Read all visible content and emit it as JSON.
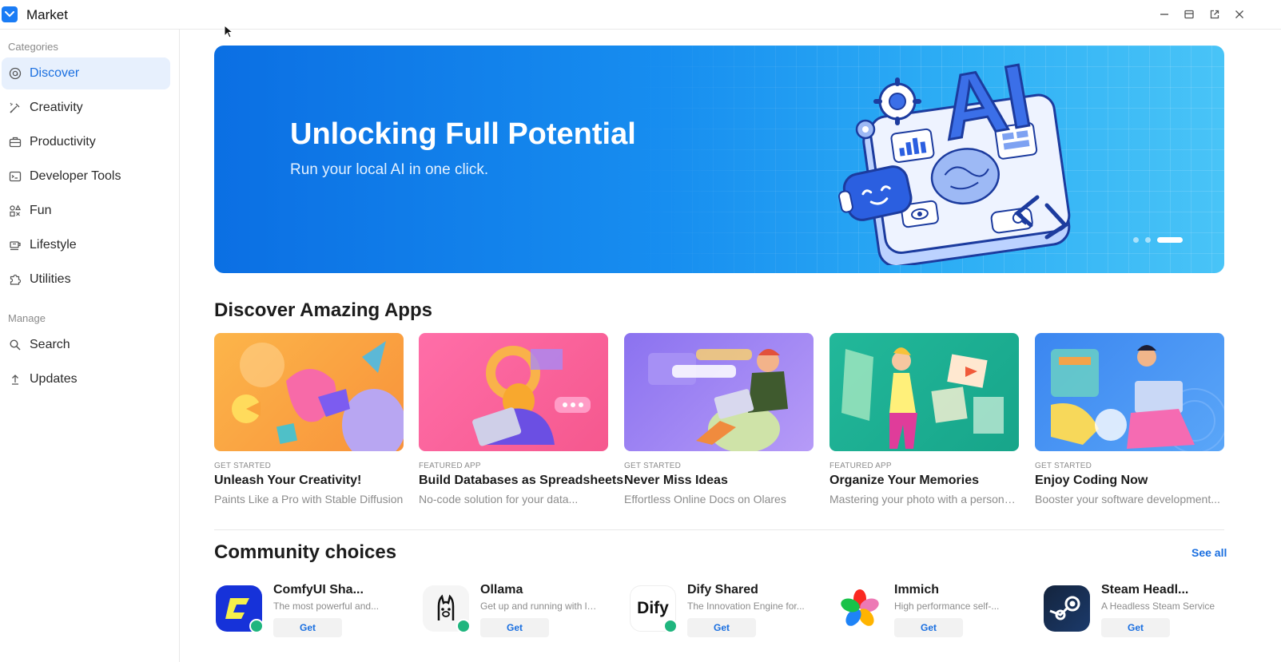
{
  "window": {
    "title": "Market"
  },
  "sidebar": {
    "categories_label": "Categories",
    "categories": [
      {
        "label": "Discover",
        "icon": "discover-icon"
      },
      {
        "label": "Creativity",
        "icon": "brush-icon"
      },
      {
        "label": "Productivity",
        "icon": "briefcase-icon"
      },
      {
        "label": "Developer Tools",
        "icon": "terminal-icon"
      },
      {
        "label": "Fun",
        "icon": "shapes-icon"
      },
      {
        "label": "Lifestyle",
        "icon": "cup-icon"
      },
      {
        "label": "Utilities",
        "icon": "puzzle-icon"
      }
    ],
    "manage_label": "Manage",
    "manage": [
      {
        "label": "Search",
        "icon": "search-icon"
      },
      {
        "label": "Updates",
        "icon": "upload-icon"
      }
    ]
  },
  "banner": {
    "title": "Unlocking Full Potential",
    "subtitle": "Run your local AI in one click.",
    "art_text": "AI"
  },
  "discover": {
    "heading": "Discover Amazing Apps",
    "cards": [
      {
        "tag": "GET STARTED",
        "title": "Unleash Your Creativity!",
        "desc": "Paints Like a Pro with Stable Diffusion"
      },
      {
        "tag": "FEATURED APP",
        "title": "Build Databases as Spreadsheets",
        "desc": "No-code solution for your data..."
      },
      {
        "tag": "GET STARTED",
        "title": "Never Miss Ideas",
        "desc": "Effortless Online Docs on Olares"
      },
      {
        "tag": "FEATURED APP",
        "title": "Organize Your Memories",
        "desc": "Mastering your photo with a personal..."
      },
      {
        "tag": "GET STARTED",
        "title": "Enjoy Coding Now",
        "desc": "Booster your software development..."
      }
    ]
  },
  "community": {
    "heading": "Community choices",
    "see_all": "See all",
    "apps": [
      {
        "name": "ComfyUI Sha...",
        "desc": "The most powerful and...",
        "get": "Get"
      },
      {
        "name": "Ollama",
        "desc": "Get up and running with lar...",
        "get": "Get"
      },
      {
        "name": "Dify Shared",
        "desc": "The Innovation Engine for...",
        "get": "Get",
        "logo_text": "Dify"
      },
      {
        "name": "Immich",
        "desc": "High performance self-...",
        "get": "Get"
      },
      {
        "name": "Steam Headl...",
        "desc": "A Headless Steam Service",
        "get": "Get"
      }
    ]
  },
  "colors": {
    "accent": "#1a6fe0",
    "active_bg": "#e7f0fd",
    "banner_start": "#0b6fe3",
    "banner_end": "#49c4f7"
  }
}
